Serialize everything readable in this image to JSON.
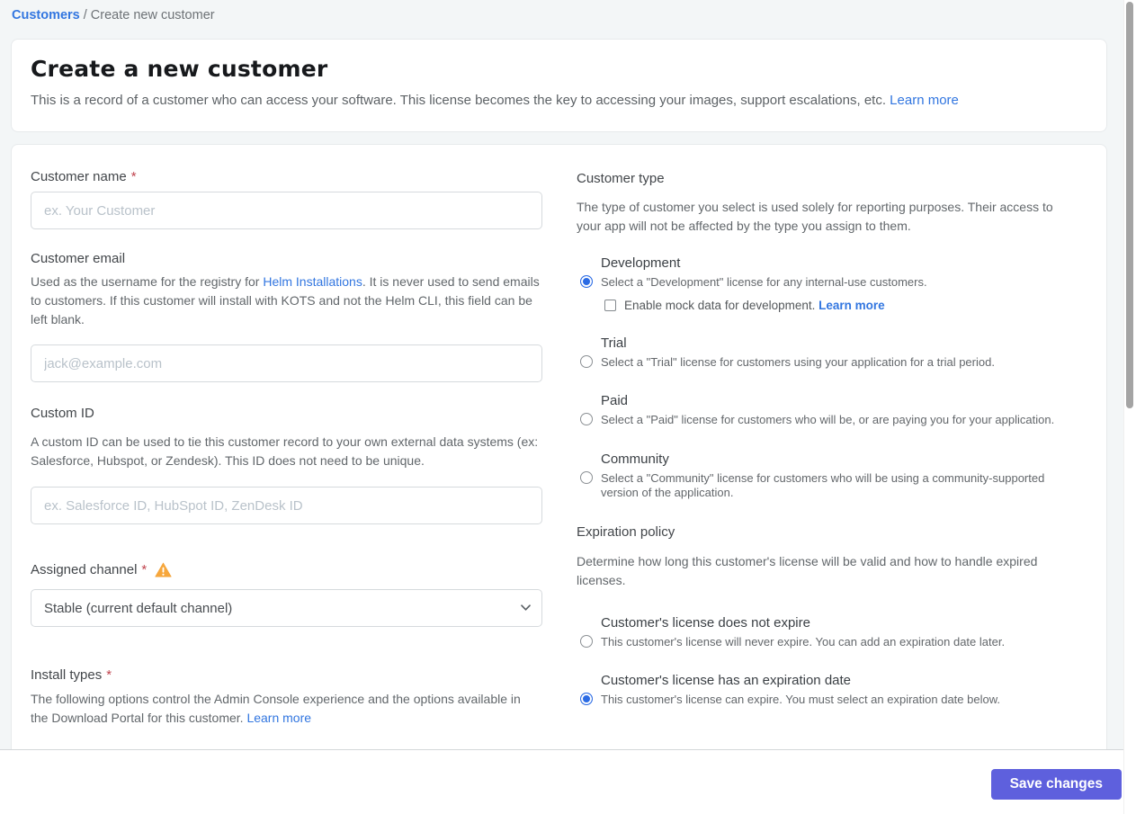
{
  "breadcrumb": {
    "link": "Customers",
    "separator": "/",
    "current": "Create new customer"
  },
  "header": {
    "title": "Create a new customer",
    "description": "This is a record of a customer who can access your software. This license becomes the key to accessing your images, support escalations, etc.",
    "learn_more": "Learn more"
  },
  "form": {
    "customer_name": {
      "label": "Customer name",
      "required": "*",
      "placeholder": "ex. Your Customer"
    },
    "customer_email": {
      "label": "Customer email",
      "description_before_link": "Used as the username for the registry for ",
      "link": "Helm Installations",
      "description_after_link": ". It is never used to send emails to customers. If this customer will install with KOTS and not the Helm CLI, this field can be left blank.",
      "placeholder": "jack@example.com"
    },
    "custom_id": {
      "label": "Custom ID",
      "description": "A custom ID can be used to tie this customer record to your own external data systems (ex: Salesforce, Hubspot, or Zendesk). This ID does not need to be unique.",
      "placeholder": "ex. Salesforce ID, HubSpot ID, ZenDesk ID"
    },
    "assigned_channel": {
      "label": "Assigned channel",
      "required": "*",
      "selected_option": "Stable (current default channel)"
    },
    "install_types": {
      "label": "Install types",
      "required": "*",
      "description": "The following options control the Admin Console experience and the options available in the Download Portal for this customer. ",
      "learn_more": "Learn more"
    }
  },
  "customer_type": {
    "heading": "Customer type",
    "description": "The type of customer you select is used solely for reporting purposes. Their access to your app will not be affected by the type you assign to them.",
    "options": [
      {
        "title": "Development",
        "description": "Select a \"Development\" license for any internal-use customers.",
        "selected": true,
        "checkbox_label": "Enable mock data for development. ",
        "checkbox_link": "Learn more",
        "checkbox_checked": false
      },
      {
        "title": "Trial",
        "description": "Select a \"Trial\" license for customers using your application for a trial period.",
        "selected": false
      },
      {
        "title": "Paid",
        "description": "Select a \"Paid\" license for customers who will be, or are paying you for your application.",
        "selected": false
      },
      {
        "title": "Community",
        "description": "Select a \"Community\" license for customers who will be using a community-supported version of the application.",
        "selected": false
      }
    ]
  },
  "expiration_policy": {
    "heading": "Expiration policy",
    "description": "Determine how long this customer's license will be valid and how to handle expired licenses.",
    "options": [
      {
        "title": "Customer's license does not expire",
        "description": "This customer's license will never expire. You can add an expiration date later.",
        "selected": false
      },
      {
        "title": "Customer's license has an expiration date",
        "description": "This customer's license can expire. You must select an expiration date below.",
        "selected": true
      }
    ]
  },
  "footer": {
    "save_label": "Save changes"
  },
  "icons": {
    "warning": "warning-triangle-icon",
    "chevron": "chevron-down-icon"
  },
  "colors": {
    "link_blue": "#3276e0",
    "radio_blue": "#2b6be4",
    "button_indigo": "#5e60dd",
    "warning_orange": "#f7a73c",
    "required_red": "#c0444e",
    "page_background": "#f3f6f7"
  }
}
